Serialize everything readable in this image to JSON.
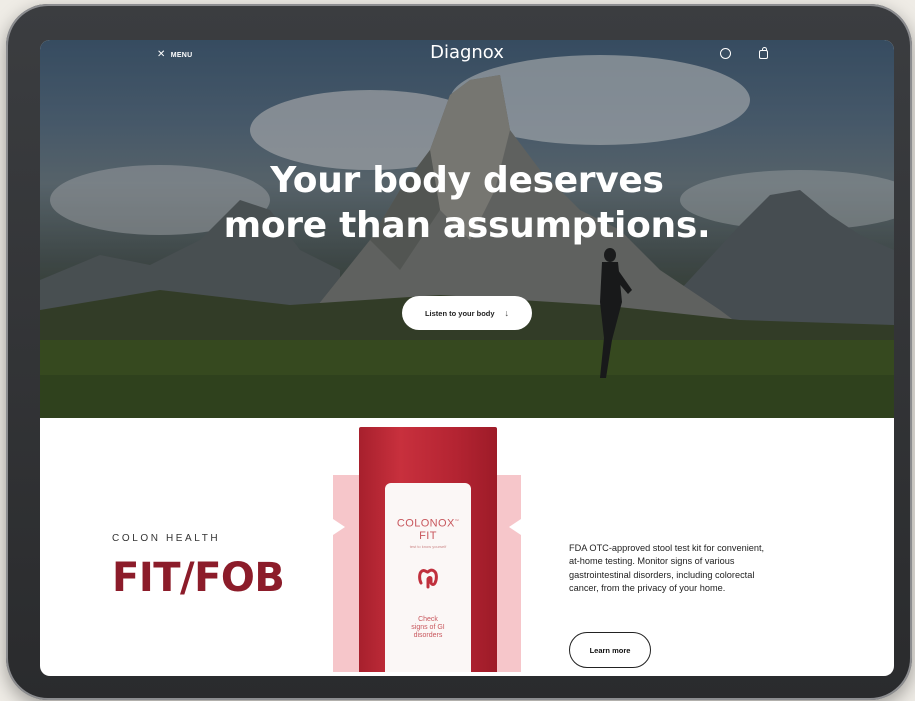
{
  "header": {
    "menu_icon": "close-icon",
    "menu_label": "MENU",
    "logo": "Diagnox",
    "account_icon": "user-circle-icon",
    "cart_icon": "shopping-bag-icon"
  },
  "hero": {
    "headline_line1": "Your body deserves",
    "headline_line2": "more than assumptions.",
    "cta_label": "Listen to your body",
    "cta_icon": "arrow-down-icon"
  },
  "product": {
    "category": "COLON HEALTH",
    "title": "FIT/FOB",
    "pouch_name_line1": "COLONOX",
    "pouch_trademark": "™",
    "pouch_name_line2": "FIT",
    "pouch_tagline": "test to know yourself",
    "pouch_icon": "colon-icon",
    "pouch_check_line1": "Check",
    "pouch_check_line2": "signs of GI",
    "pouch_check_line3": "disorders",
    "description": "FDA OTC-approved stool test kit for convenient, at-home testing. Monitor signs of various gastrointestinal disorders, including colorectal cancer, from the privacy of your home.",
    "learn_more_label": "Learn more"
  },
  "colors": {
    "brand_red": "#8c1c2a",
    "pouch_red": "#b42432",
    "pouch_pink": "#f6c6ca"
  }
}
